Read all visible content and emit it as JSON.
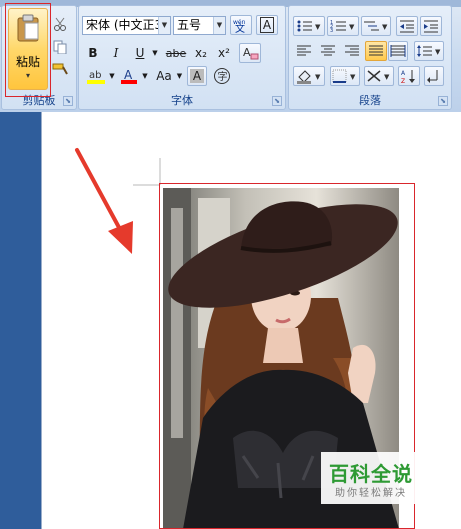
{
  "clipboard": {
    "paste_label": "粘贴",
    "group_label": "剪贴板"
  },
  "font": {
    "name_value": "宋体 (中文正3",
    "size_value": "五号",
    "group_label": "字体",
    "bold": "B",
    "italic": "I",
    "underline": "U",
    "strike": "abe",
    "subscript": "x₂",
    "superscript": "x²",
    "grow": "A",
    "clear_format": "A",
    "case": "Aa",
    "highlight_color": "#ffff00",
    "font_color": "#ff0000"
  },
  "paragraph": {
    "group_label": "段落"
  },
  "watermark": {
    "title": "百科全说",
    "subtitle": "助你轻松解决",
    "color": "#2e9a34"
  },
  "colors": {
    "selection_border": "#d9262c",
    "arrow": "#e53a2c",
    "ribbon_text": "#15428b"
  },
  "icons": [
    "scissors-icon",
    "copy-icon",
    "format-painter-icon",
    "clipboard-paste-icon",
    "phonetic-guide-icon",
    "char-border-icon",
    "bullets-icon",
    "numbering-icon",
    "multilevel-list-icon",
    "decrease-indent-icon",
    "increase-indent-icon",
    "align-left-icon",
    "align-center-icon",
    "align-right-icon",
    "justify-icon",
    "distributed-icon",
    "line-spacing-icon",
    "shading-icon",
    "borders-icon",
    "sort-icon",
    "show-marks-icon",
    "chinese-layout-icon",
    "enclose-char-icon"
  ]
}
